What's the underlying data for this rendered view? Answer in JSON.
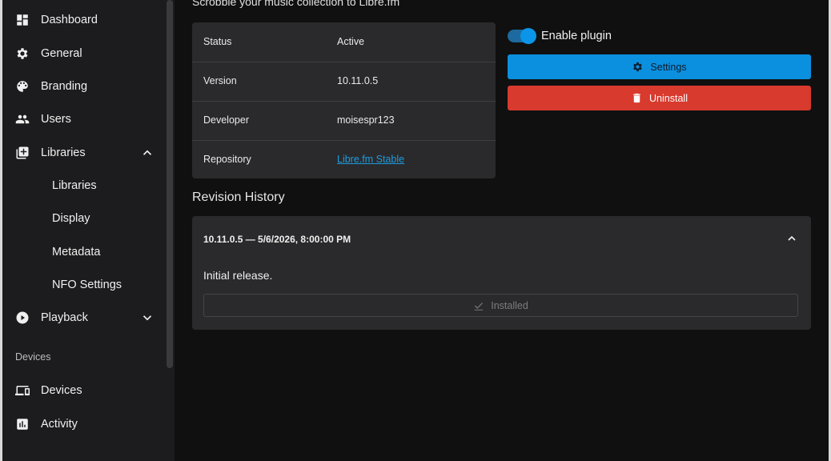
{
  "sidebar": {
    "items": [
      {
        "label": "Dashboard",
        "icon": "dashboard-icon"
      },
      {
        "label": "General",
        "icon": "gear-icon"
      },
      {
        "label": "Branding",
        "icon": "palette-icon"
      },
      {
        "label": "Users",
        "icon": "users-icon"
      },
      {
        "label": "Libraries",
        "icon": "library-add-icon",
        "expanded": true
      },
      {
        "label": "Playback",
        "icon": "play-circle-icon",
        "expanded": false
      }
    ],
    "sub_items": [
      "Libraries",
      "Display",
      "Metadata",
      "NFO Settings"
    ],
    "devices_section": "Devices",
    "devices_items": [
      {
        "label": "Devices",
        "icon": "devices-icon"
      },
      {
        "label": "Activity",
        "icon": "activity-chart-icon"
      }
    ]
  },
  "plugin": {
    "description": "Scrobble your music collection to Libre.fm",
    "info": [
      {
        "key": "Status",
        "value": "Active"
      },
      {
        "key": "Version",
        "value": "10.11.0.5"
      },
      {
        "key": "Developer",
        "value": "moisespr123"
      },
      {
        "key": "Repository",
        "value": "Libre.fm Stable"
      }
    ],
    "enable_label": "Enable plugin",
    "enabled": true,
    "settings_label": "Settings",
    "uninstall_label": "Uninstall"
  },
  "revision": {
    "title": "Revision History",
    "entry_header": "10.11.0.5 — 5/6/2026, 8:00:00 PM",
    "entry_body": "Initial release.",
    "installed_label": "Installed"
  },
  "colors": {
    "accent": "#0b90e0",
    "danger": "#d83a2e",
    "link": "#1e9bdf"
  }
}
